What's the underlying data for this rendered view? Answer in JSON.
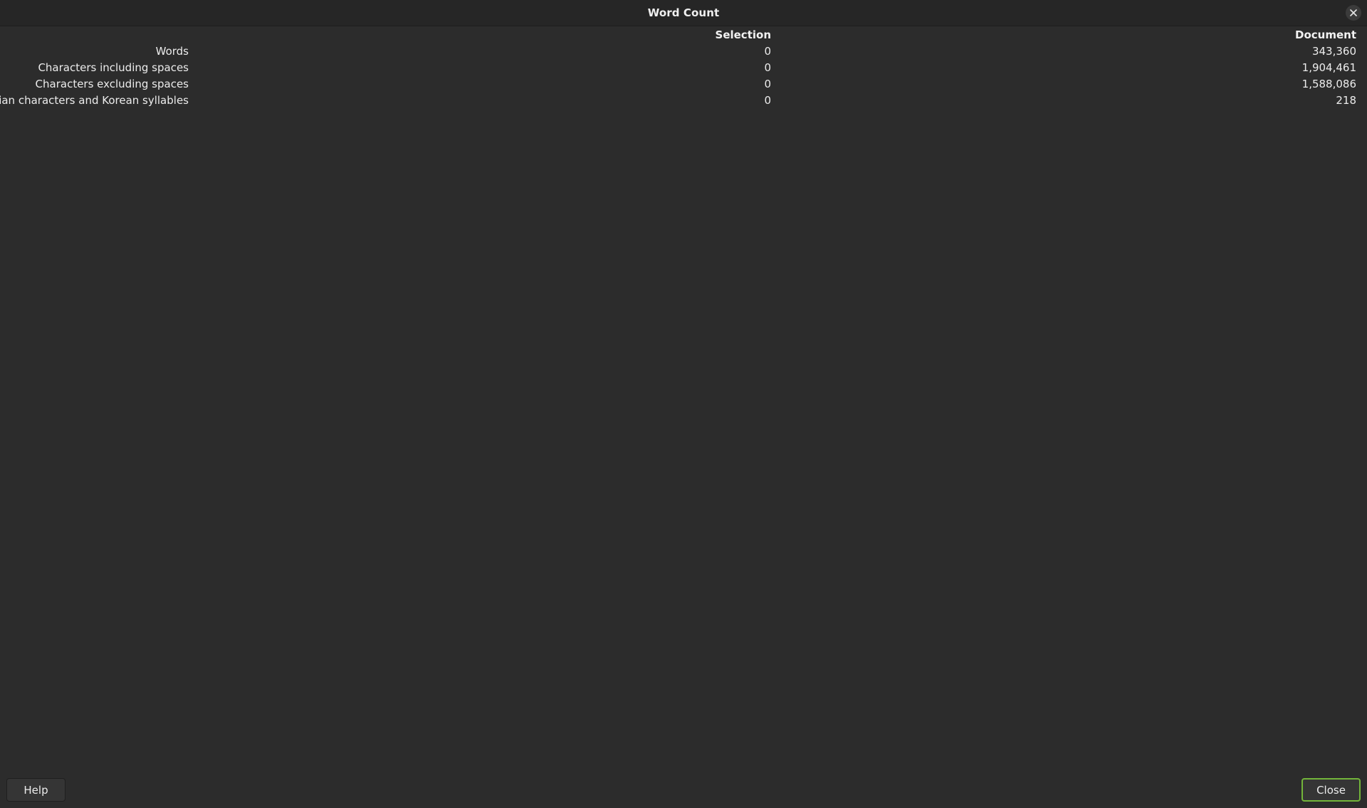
{
  "window": {
    "title": "Word Count",
    "close_icon": "close-icon"
  },
  "table": {
    "headers": {
      "selection": "Selection",
      "document": "Document"
    },
    "rows": [
      {
        "label": "Words",
        "selection": "0",
        "document": "343,360"
      },
      {
        "label": "Characters including spaces",
        "selection": "0",
        "document": "1,904,461"
      },
      {
        "label": "Characters excluding spaces",
        "selection": "0",
        "document": "1,588,086"
      },
      {
        "label": "Asian characters and Korean syllables",
        "selection": "0",
        "document": "218"
      }
    ]
  },
  "buttons": {
    "help_label": "Help",
    "close_label": "Close"
  },
  "colors": {
    "background": "#2c2c2c",
    "titlebar": "#262626",
    "default_button_border": "#73b53a"
  }
}
